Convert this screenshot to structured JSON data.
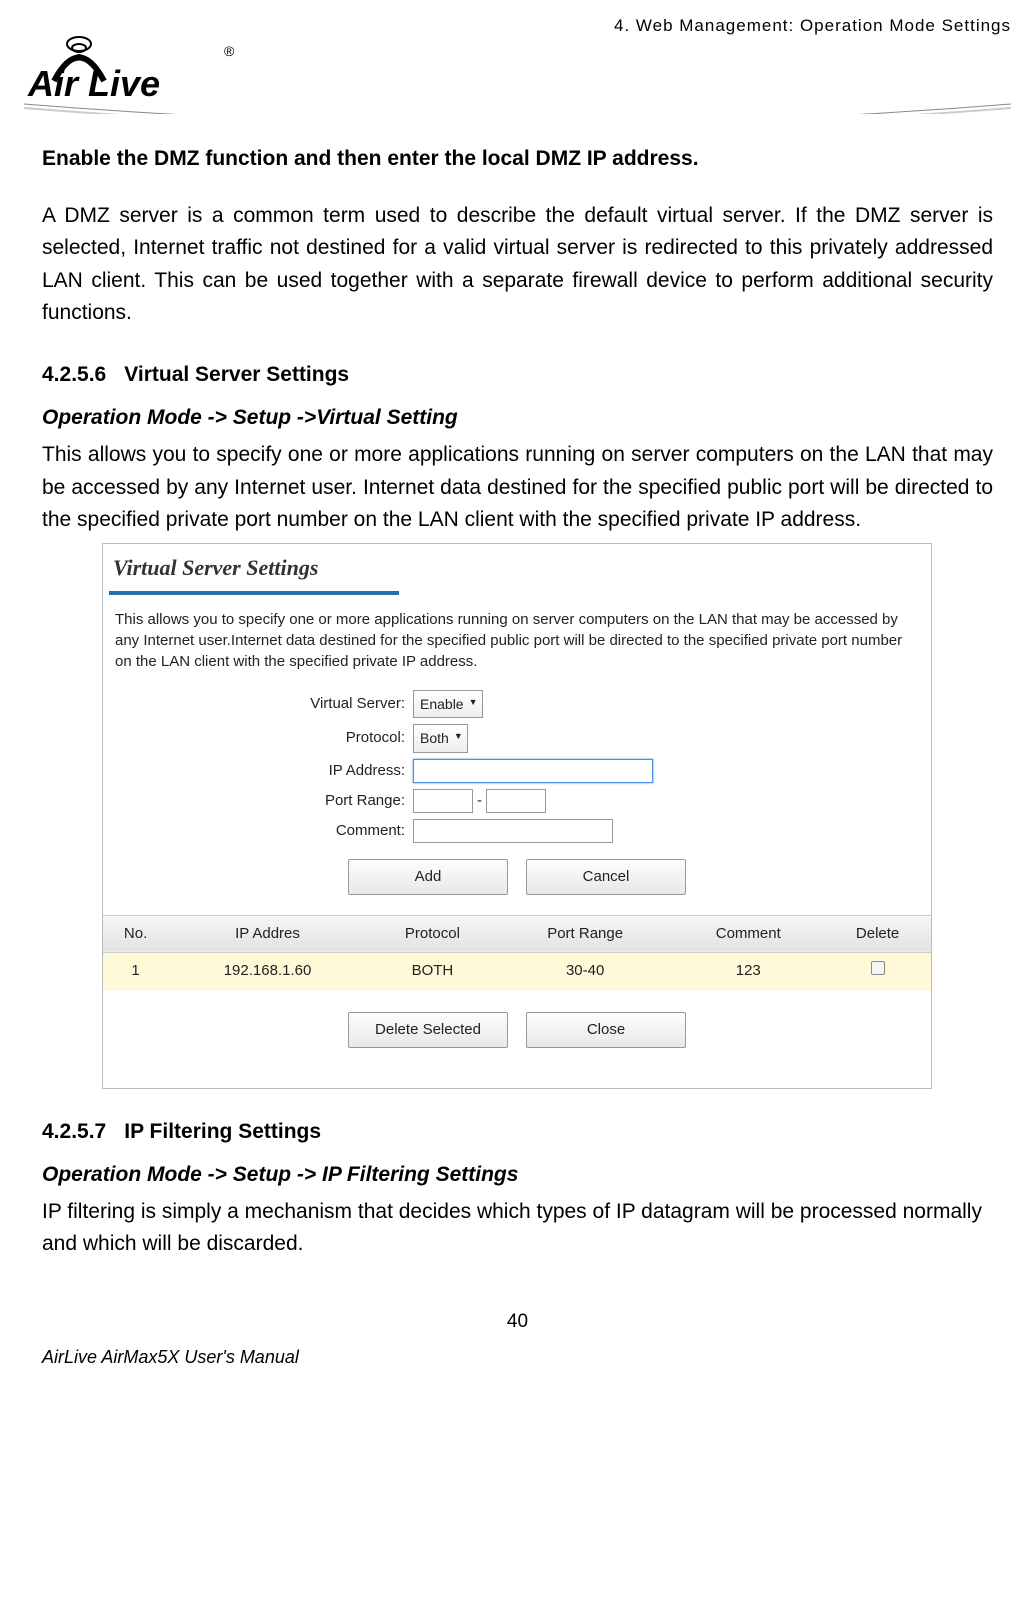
{
  "header": {
    "chapter": "4.  Web  Management:  Operation  Mode  Settings",
    "logo_text": "Air Live",
    "logo_r": "®"
  },
  "body": {
    "dmz_heading": "Enable the DMZ function and then enter the local DMZ IP address.",
    "dmz_para": "A DMZ server is a common term used to describe the default virtual server. If the DMZ server is selected, Internet traffic not destined for a valid virtual server is redirected to this privately addressed LAN client. This can be used together with a separate firewall device to perform additional security functions.",
    "sec6_num": "4.2.5.6",
    "sec6_title": "Virtual Server Settings",
    "sec6_breadcrumb": "Operation Mode -> Setup ->Virtual Setting",
    "sec6_para": "This allows you to specify one or more applications running on server computers on the LAN that may be accessed by any Internet user. Internet data destined for the specified public port will be directed to the specified private port number on the LAN client with the specified private IP address.",
    "sec7_num": "4.2.5.7",
    "sec7_title": "IP Filtering Settings",
    "sec7_breadcrumb": "Operation Mode -> Setup -> IP Filtering Settings",
    "sec7_para": "IP filtering is simply a mechanism that decides which types of IP datagram will be processed normally and which will be discarded."
  },
  "panel": {
    "title": "Virtual Server Settings",
    "desc": "This allows you to specify one or more applications running on server computers on the LAN that may be accessed by any Internet user.Internet data destined for the specified public port will be directed to the specified private port number on the LAN client with the specified private IP address.",
    "labels": {
      "virtual_server": "Virtual Server:",
      "protocol": "Protocol:",
      "ip_address": "IP Address:",
      "port_range": "Port Range:",
      "comment": "Comment:"
    },
    "values": {
      "virtual_server": "Enable",
      "protocol": "Both",
      "ip_address": "",
      "port_from": "",
      "port_to": "",
      "port_sep": "-",
      "comment": ""
    },
    "buttons": {
      "add": "Add",
      "cancel": "Cancel",
      "delete_selected": "Delete Selected",
      "close": "Close"
    },
    "table": {
      "headers": [
        "No.",
        "IP Addres",
        "Protocol",
        "Port Range",
        "Comment",
        "Delete"
      ],
      "rows": [
        {
          "no": "1",
          "ip": "192.168.1.60",
          "protocol": "BOTH",
          "port": "30-40",
          "comment": "123"
        }
      ]
    }
  },
  "footer": {
    "page_no": "40",
    "manual": "AirLive AirMax5X User's Manual"
  }
}
